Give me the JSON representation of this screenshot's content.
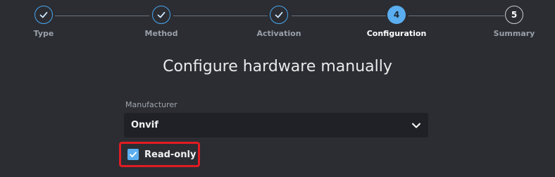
{
  "stepper": {
    "steps": [
      {
        "label": "Type",
        "number": "1",
        "state": "done"
      },
      {
        "label": "Method",
        "number": "2",
        "state": "done"
      },
      {
        "label": "Activation",
        "number": "3",
        "state": "done"
      },
      {
        "label": "Configuration",
        "number": "4",
        "state": "current"
      },
      {
        "label": "Summary",
        "number": "5",
        "state": "todo"
      }
    ]
  },
  "main": {
    "title": "Configure hardware manually",
    "manufacturer": {
      "label": "Manufacturer",
      "value": "Onvif"
    },
    "read_only": {
      "label": "Read-only",
      "checked": true
    }
  },
  "colors": {
    "accent": "#5aaef0",
    "highlight_border": "#e01c22",
    "background": "#2b2d33"
  }
}
